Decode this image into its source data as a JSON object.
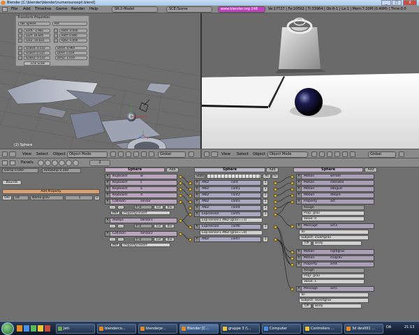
{
  "window": {
    "title": "Blender [C:\\blender\\blender\\numerounospil.blend]",
    "minimize": "_",
    "maximize": "□",
    "close": "X"
  },
  "header": {
    "menus": [
      "File",
      "Add",
      "Timeline",
      "Game",
      "Render",
      "Help"
    ],
    "screen": "SR:2-Model",
    "scene": "SCE:Scene",
    "url": "www.blender.org 248",
    "stats": "Ve:17727 | Fa:10592 | Ti:33964 | Ob:6-1 | La:1 | Mem:7.20M (0.49M) | Time:0.0"
  },
  "viewport_left": {
    "panel_title": "Transform Properties",
    "ob_name": "OB: Sphere",
    "par": "Par:",
    "loc": [
      "LocX: -2.942",
      "LocY: 16.645",
      "LocZ: 10.833"
    ],
    "rot": [
      "RotX: 0.000",
      "RotY: 0.000",
      "RotZ: 0.000"
    ],
    "scale": [
      "ScaleX: 0.510",
      "ScaleY: 0.510",
      "ScaleZ: 0.510"
    ],
    "dim": [
      "DimX: 0.969",
      "DimY: 1.019",
      "DimZ: 1.019"
    ],
    "link_scale": "Link Scale",
    "object_label": "(2) Sphere"
  },
  "view_header": {
    "menus": [
      "View",
      "Select",
      "Object"
    ],
    "mode": "Object Mode",
    "orient": "Global"
  },
  "logic_header": {
    "panels": "Panels",
    "frame": "2"
  },
  "physics": {
    "damp": "Damp 0.040",
    "rotdamp": "RotDamp 0.100",
    "bounds": "Bounds",
    "add_property": "Add Property",
    "prop_del": "Del",
    "prop_type": "Int",
    "prop_name": "Name:grav",
    "prop_value": "1",
    "prop_d": "D"
  },
  "sensors": {
    "header": "Sphere",
    "add": "Add",
    "items": [
      {
        "type": "Keyboard",
        "key": "w"
      },
      {
        "type": "Keyboard",
        "key": "s"
      },
      {
        "type": "Keyboard",
        "key": "a"
      },
      {
        "type": "Keyboard",
        "key": "d"
      },
      {
        "type": "Collision",
        "key": "sensor"
      },
      {
        "type": "Always",
        "key": "sensor1"
      },
      {
        "type": "Collision",
        "key": "sensor2"
      }
    ],
    "collision_prop": "Property:invert",
    "collision_prop2": "Property:revert",
    "mp": "M/P",
    "lvl": "Lvl",
    "inv": "Inv",
    "f": "f: 0"
  },
  "controllers": {
    "header": "Sphere",
    "add": "Add",
    "state": "Stats",
    "all": "All",
    "ini": "Ini",
    "items": [
      {
        "type": "AND",
        "name": "cont"
      },
      {
        "type": "AND",
        "name": "cont1"
      },
      {
        "type": "AND",
        "name": "cont2"
      },
      {
        "type": "AND",
        "name": "cont3"
      },
      {
        "type": "AND",
        "name": "cont4"
      },
      {
        "type": "Expression",
        "name": "cont5"
      },
      {
        "type": "Expression",
        "name": "cont6"
      },
      {
        "type": "AND",
        "name": "cont7"
      }
    ],
    "exp1": "Exp:sensor1 AND (grav==1)",
    "exp2": "Exp:sensor1 AND (grav==0)"
  },
  "actuators": {
    "header": "Sphere",
    "add": "Add",
    "items": [
      {
        "type": "Motion",
        "name": "wFrem"
      },
      {
        "type": "Motion",
        "name": "sVenstre"
      },
      {
        "type": "Motion",
        "name": "sBagud"
      },
      {
        "type": "Motion",
        "name": "dHojre"
      },
      {
        "type": "Property",
        "name": "act"
      },
      {
        "type": "Message",
        "name": "act3"
      },
      {
        "type": "Motion",
        "name": "rightgrav"
      },
      {
        "type": "Motion",
        "name": "invgrav"
      },
      {
        "type": "Property",
        "name": "act4"
      },
      {
        "type": "Message",
        "name": "act5"
      }
    ],
    "assign": "Assign",
    "prop_grav": "Prop: grav",
    "value0": "Value: 0",
    "value1": "Value: 1",
    "to": "To:",
    "subject1": "Subject: invertgrav",
    "subject2": "Subject: revertgrav",
    "tp": "T/P",
    "body": "Body"
  },
  "taskbar": {
    "items": [
      "Jeti",
      "blenderco...",
      "blenderpr...",
      "Blender [C...",
      "gruppe 3 (\\...",
      "Computer",
      "Controllers ...",
      "3d dev001 ..."
    ],
    "lang": "DA",
    "clock": "21:13"
  }
}
